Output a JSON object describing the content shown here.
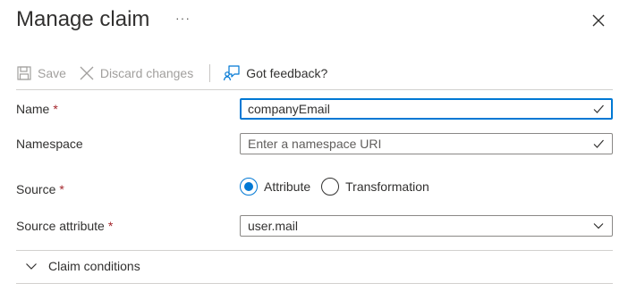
{
  "header": {
    "title": "Manage claim",
    "more_label": "···"
  },
  "toolbar": {
    "save_label": "Save",
    "discard_label": "Discard changes",
    "feedback_label": "Got feedback?"
  },
  "form": {
    "name": {
      "label": "Name",
      "required": "*",
      "value": "companyEmail"
    },
    "namespace": {
      "label": "Namespace",
      "placeholder": "Enter a namespace URI"
    },
    "source": {
      "label": "Source",
      "required": "*",
      "options": [
        "Attribute",
        "Transformation"
      ],
      "selected": "Attribute"
    },
    "source_attribute": {
      "label": "Source attribute",
      "required": "*",
      "value": "user.mail"
    }
  },
  "conditions": {
    "label": "Claim conditions"
  },
  "colors": {
    "accent": "#0078d4",
    "required": "#a4262c",
    "disabled": "#a19f9d"
  }
}
